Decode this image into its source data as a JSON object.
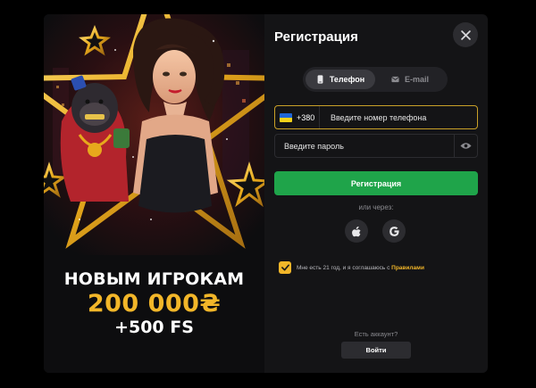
{
  "modal": {
    "title": "Регистрация",
    "close_icon": "close-icon"
  },
  "promo": {
    "line1": "НОВЫМ ИГРОКАМ",
    "line2": "200 000₴",
    "line3": "+500 FS",
    "colors": {
      "gold": "#f2b629",
      "star_outline": "#e7a91c"
    }
  },
  "tabs": [
    {
      "label": "Телефон",
      "icon": "phone-icon",
      "active": true
    },
    {
      "label": "E-mail",
      "icon": "mail-icon",
      "active": false
    }
  ],
  "phone": {
    "country_flag": "ukraine-flag-icon",
    "country_code": "+380",
    "placeholder": "Введите номер телефона",
    "value": ""
  },
  "password": {
    "placeholder": "Введите пароль",
    "value": "",
    "toggle_icon": "eye-icon"
  },
  "submit_label": "Регистрация",
  "social": {
    "divider": "или через:",
    "providers": [
      {
        "name": "Apple",
        "icon": "apple-icon"
      },
      {
        "name": "Google",
        "icon": "google-icon"
      }
    ]
  },
  "agreement": {
    "checked": true,
    "text": "Мне есть 21 год, и я соглашаюсь с ",
    "link": "Правилами"
  },
  "login": {
    "prompt": "Есть аккаунт?",
    "button": "Войти"
  },
  "colors": {
    "accent_green": "#1fa44a",
    "accent_gold": "#f2b629",
    "panel_bg": "#141416",
    "input_border_active": "#c9a028"
  }
}
